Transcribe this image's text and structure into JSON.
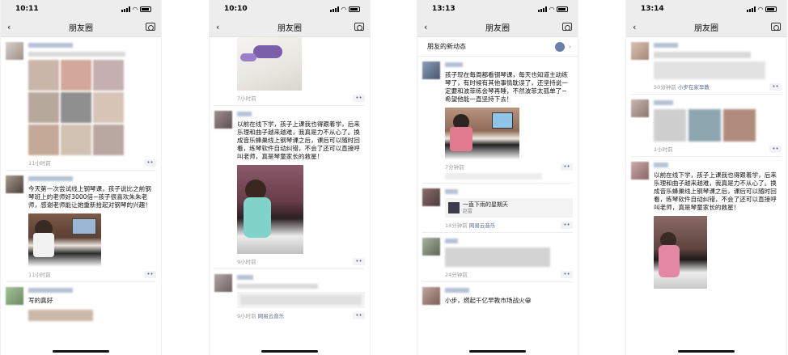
{
  "phones": [
    {
      "status_time": "10:11",
      "nav_title": "朋友圈",
      "posts": [
        {
          "text": "",
          "time": "11小时前"
        },
        {
          "text": "今天第一次尝试线上钢琴课，孩子说比之前钢琴班上的老师好3000倍~孩子很喜欢朱朱老师，感谢老师能让她重新拾起对钢琴的兴趣！",
          "time": "11小时前"
        },
        {
          "text": "写的真好",
          "time": ""
        }
      ]
    },
    {
      "status_time": "10:10",
      "nav_title": "朋友圈",
      "posts": [
        {
          "text": "",
          "time": "7小时前"
        },
        {
          "text": "以前在线下学，孩子上课我也得跟着学，后来乐理和曲子越来越难，我真是力不从心了。换成音乐蜂巢线上钢琴课之后，课后可以随时回看，练琴软件自动纠错，不会了还可以直接呼叫老师，真是琴童家长的救星！",
          "time": "9小时前"
        },
        {
          "text": "",
          "time": "9小时前",
          "music_source": "网易云音乐"
        }
      ]
    },
    {
      "status_time": "13:13",
      "nav_title": "朋友圈",
      "new_feeds_label": "朋友的新动态",
      "posts": [
        {
          "text": "孩子现在每周都看钢琴课，每天也知道主动练琴了，有时候有其他事情耽误了，还坚持说一定要和波菲练会琴再睡，不然波菲太孤单了~希望他能一直坚持下去！",
          "time": "7分钟前"
        },
        {
          "text": "",
          "time": "14分钟前",
          "music_title": "一直下雨的星期天",
          "music_artist": "赵雷",
          "music_source": "网易云音乐"
        },
        {
          "text": "",
          "time": "24分钟前"
        },
        {
          "text": "小步，燃起千亿早教市场战火😁",
          "time": ""
        }
      ]
    },
    {
      "status_time": "13:14",
      "nav_title": "朋友圈",
      "posts": [
        {
          "text": "",
          "time": "50分钟前",
          "source": "小步在家早教"
        },
        {
          "text": "",
          "time": "1小时前"
        },
        {
          "text": "以前在线下学，孩子上课我也得跟着学，后来乐理和曲子越来越难，我真是力不从心了。换成音乐蜂巢线上钢琴课之后，课后可以随时回看，练琴软件自动纠错，不会了还可以直接呼叫老师，真是琴童家长的救星！",
          "time": ""
        }
      ]
    }
  ],
  "colors": {
    "nav_bg": "#ededed",
    "link": "#576b95",
    "meta": "#9a9a9a"
  },
  "icons": [
    "back-arrow-icon",
    "camera-icon",
    "more-dots-icon",
    "signal-icon",
    "wifi-icon",
    "battery-icon"
  ]
}
